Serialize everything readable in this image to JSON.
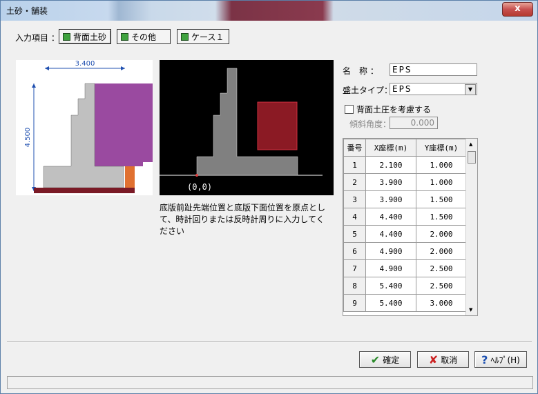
{
  "window": {
    "title": "土砂・舗装",
    "close_label": "x"
  },
  "input_items": {
    "label": "入力項目 ：",
    "tabs": [
      {
        "label": "背面土砂",
        "active": true
      },
      {
        "label": "その他",
        "active": false
      },
      {
        "label": "ケース１",
        "active": false
      }
    ]
  },
  "preview": {
    "width_label": "3.400",
    "height_label": "4.500"
  },
  "canvas": {
    "origin_label": "(0,0)"
  },
  "note": "底版前趾先端位置と底版下面位置を原点として、時計回りまたは反時計周りに入力してください",
  "form": {
    "name_label": "名　称 ：",
    "name_value": "EPS",
    "type_label": "盛土タイプ：",
    "type_value": "EPS",
    "checkbox_label": "背面土圧を考慮する",
    "angle_label": "傾斜角度：",
    "angle_value": "0.000"
  },
  "grid": {
    "headers": [
      "番号",
      "X座標(m)",
      "Y座標(m)"
    ],
    "rows": [
      [
        "1",
        "2.100",
        "1.000"
      ],
      [
        "2",
        "3.900",
        "1.000"
      ],
      [
        "3",
        "3.900",
        "1.500"
      ],
      [
        "4",
        "4.400",
        "1.500"
      ],
      [
        "5",
        "4.400",
        "2.000"
      ],
      [
        "6",
        "4.900",
        "2.000"
      ],
      [
        "7",
        "4.900",
        "2.500"
      ],
      [
        "8",
        "5.400",
        "2.500"
      ],
      [
        "9",
        "5.400",
        "3.000"
      ]
    ]
  },
  "buttons": {
    "ok": "確定",
    "cancel": "取消",
    "help": "ﾍﾙﾌﾟ(H)"
  },
  "colors": {
    "soil_fill": "#9a4aa0",
    "eps_fill": "#8b1a24",
    "wall_fill": "#c0c0c0"
  }
}
